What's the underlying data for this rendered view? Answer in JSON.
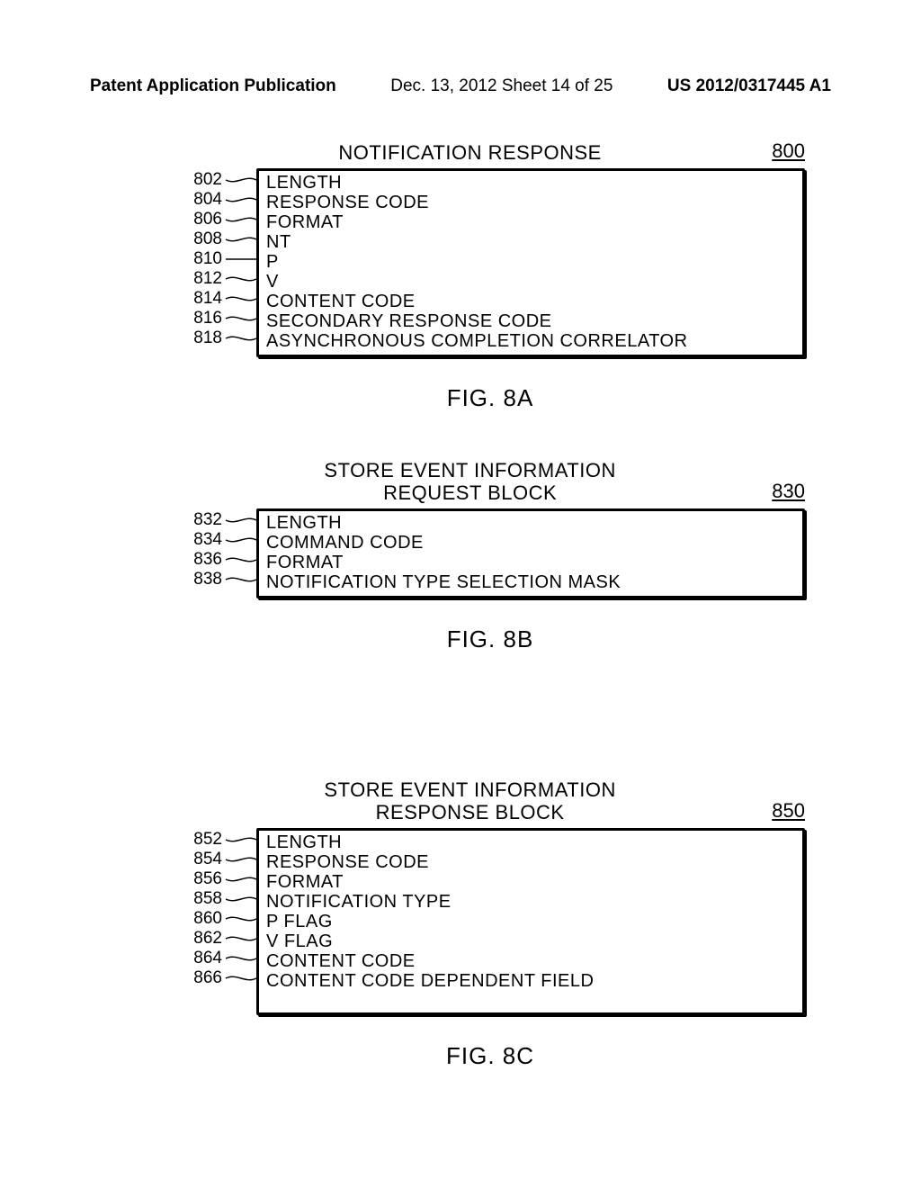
{
  "header": {
    "left": "Patent Application Publication",
    "mid": "Dec. 13, 2012  Sheet 14 of 25",
    "right": "US 2012/0317445 A1"
  },
  "figA": {
    "title": "NOTIFICATION RESPONSE",
    "ref": "800",
    "caption": "FIG. 8A",
    "rows": [
      {
        "num": "802",
        "label": "LENGTH"
      },
      {
        "num": "804",
        "label": "RESPONSE CODE"
      },
      {
        "num": "806",
        "label": "FORMAT"
      },
      {
        "num": "808",
        "label": "NT"
      },
      {
        "num": "810",
        "label": "P"
      },
      {
        "num": "812",
        "label": "V"
      },
      {
        "num": "814",
        "label": "CONTENT CODE"
      },
      {
        "num": "816",
        "label": "SECONDARY RESPONSE CODE"
      },
      {
        "num": "818",
        "label": "ASYNCHRONOUS COMPLETION CORRELATOR"
      }
    ]
  },
  "figB": {
    "title_line1": "STORE EVENT INFORMATION",
    "title_line2": "REQUEST BLOCK",
    "ref": "830",
    "caption": "FIG. 8B",
    "rows": [
      {
        "num": "832",
        "label": "LENGTH"
      },
      {
        "num": "834",
        "label": "COMMAND CODE"
      },
      {
        "num": "836",
        "label": "FORMAT"
      },
      {
        "num": "838",
        "label": "NOTIFICATION TYPE SELECTION MASK"
      }
    ]
  },
  "figC": {
    "title_line1": "STORE EVENT INFORMATION",
    "title_line2": "RESPONSE BLOCK",
    "ref": "850",
    "caption": "FIG. 8C",
    "rows": [
      {
        "num": "852",
        "label": "LENGTH"
      },
      {
        "num": "854",
        "label": "RESPONSE CODE"
      },
      {
        "num": "856",
        "label": "FORMAT"
      },
      {
        "num": "858",
        "label": "NOTIFICATION TYPE"
      },
      {
        "num": "860",
        "label": "P FLAG"
      },
      {
        "num": "862",
        "label": "V FLAG"
      },
      {
        "num": "864",
        "label": "CONTENT CODE"
      },
      {
        "num": "866",
        "label": "CONTENT CODE DEPENDENT FIELD"
      }
    ]
  }
}
